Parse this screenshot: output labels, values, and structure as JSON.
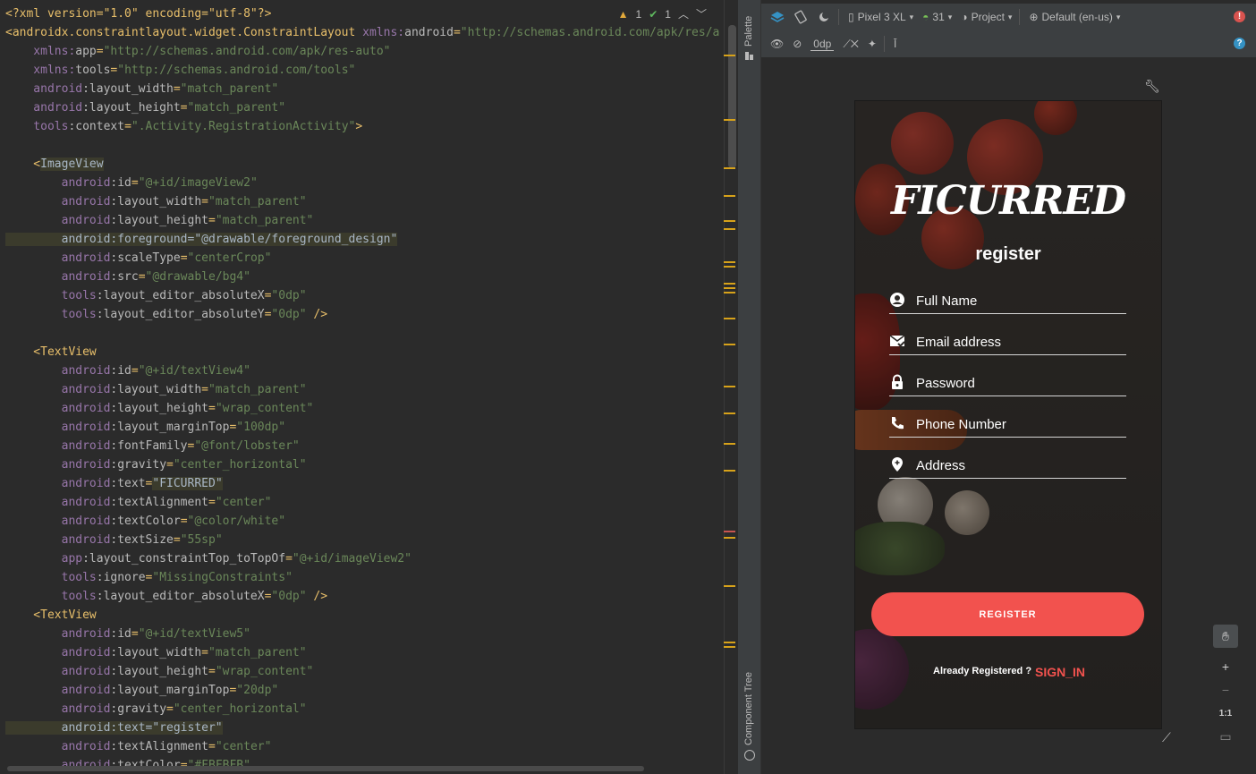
{
  "editor": {
    "inspection": {
      "warnings": "1",
      "typos": "1"
    },
    "lines": [
      [
        [
          "pi",
          "<?xml version=\"1.0\" encoding=\"utf-8\"?>"
        ]
      ],
      [
        [
          "lt",
          "<androidx.constraintlayout.widget.ConstraintLayout "
        ],
        [
          "ns",
          "xmlns:"
        ],
        [
          "an",
          "android"
        ],
        [
          "lt",
          "="
        ],
        [
          "av",
          "\"http://schemas.android.com/apk/res/a"
        ]
      ],
      [
        [
          "ns",
          "    xmlns:"
        ],
        [
          "an",
          "app"
        ],
        [
          "lt",
          "="
        ],
        [
          "av",
          "\"http://schemas.android.com/apk/res-auto\""
        ]
      ],
      [
        [
          "ns",
          "    xmlns:"
        ],
        [
          "an",
          "tools"
        ],
        [
          "lt",
          "="
        ],
        [
          "av",
          "\"http://schemas.android.com/tools\""
        ]
      ],
      [
        [
          "ns",
          "    android"
        ],
        [
          "an",
          ":layout_width"
        ],
        [
          "lt",
          "="
        ],
        [
          "av",
          "\"match_parent\""
        ]
      ],
      [
        [
          "ns",
          "    android"
        ],
        [
          "an",
          ":layout_height"
        ],
        [
          "lt",
          "="
        ],
        [
          "av",
          "\"match_parent\""
        ]
      ],
      [
        [
          "ns",
          "    tools"
        ],
        [
          "an",
          ":context"
        ],
        [
          "lt",
          "="
        ],
        [
          "av",
          "\".Activity.RegistrationActivity\""
        ],
        [
          "lt",
          ">"
        ]
      ],
      [
        [
          "an",
          ""
        ]
      ],
      [
        [
          "lt",
          "    <"
        ],
        [
          "hl",
          "ImageView"
        ]
      ],
      [
        [
          "ns",
          "        android"
        ],
        [
          "an",
          ":id"
        ],
        [
          "lt",
          "="
        ],
        [
          "av",
          "\"@+id/imageView2\""
        ]
      ],
      [
        [
          "ns",
          "        android"
        ],
        [
          "an",
          ":layout_width"
        ],
        [
          "lt",
          "="
        ],
        [
          "av",
          "\"match_parent\""
        ]
      ],
      [
        [
          "ns",
          "        android"
        ],
        [
          "an",
          ":layout_height"
        ],
        [
          "lt",
          "="
        ],
        [
          "av",
          "\"match_parent\""
        ]
      ],
      [
        [
          "hl",
          "        android:foreground=\"@drawable/foreground_design\""
        ]
      ],
      [
        [
          "ns",
          "        android"
        ],
        [
          "an",
          ":scaleType"
        ],
        [
          "lt",
          "="
        ],
        [
          "av",
          "\"centerCrop\""
        ]
      ],
      [
        [
          "ns",
          "        android"
        ],
        [
          "an",
          ":src"
        ],
        [
          "lt",
          "="
        ],
        [
          "av",
          "\"@drawable/bg4\""
        ]
      ],
      [
        [
          "ns",
          "        tools"
        ],
        [
          "an",
          ":layout_editor_absoluteX"
        ],
        [
          "lt",
          "="
        ],
        [
          "av",
          "\"0dp\""
        ]
      ],
      [
        [
          "ns",
          "        tools"
        ],
        [
          "an",
          ":layout_editor_absoluteY"
        ],
        [
          "lt",
          "="
        ],
        [
          "av",
          "\"0dp\""
        ],
        [
          "lt",
          " />"
        ]
      ],
      [
        [
          "an",
          ""
        ]
      ],
      [
        [
          "lt",
          "    <TextView"
        ]
      ],
      [
        [
          "ns",
          "        android"
        ],
        [
          "an",
          ":id"
        ],
        [
          "lt",
          "="
        ],
        [
          "av",
          "\"@+id/textView4\""
        ]
      ],
      [
        [
          "ns",
          "        android"
        ],
        [
          "an",
          ":layout_width"
        ],
        [
          "lt",
          "="
        ],
        [
          "av",
          "\"match_parent\""
        ]
      ],
      [
        [
          "ns",
          "        android"
        ],
        [
          "an",
          ":layout_height"
        ],
        [
          "lt",
          "="
        ],
        [
          "av",
          "\"wrap_content\""
        ]
      ],
      [
        [
          "ns",
          "        android"
        ],
        [
          "an",
          ":layout_marginTop"
        ],
        [
          "lt",
          "="
        ],
        [
          "av",
          "\"100dp\""
        ]
      ],
      [
        [
          "ns",
          "        android"
        ],
        [
          "an",
          ":fontFamily"
        ],
        [
          "lt",
          "="
        ],
        [
          "av",
          "\"@font/lobster\""
        ]
      ],
      [
        [
          "ns",
          "        android"
        ],
        [
          "an",
          ":gravity"
        ],
        [
          "lt",
          "="
        ],
        [
          "av",
          "\"center_horizontal\""
        ]
      ],
      [
        [
          "ns",
          "        android"
        ],
        [
          "an",
          ":text"
        ],
        [
          "lt",
          "="
        ],
        [
          "hl",
          "\"FICURRED\""
        ]
      ],
      [
        [
          "ns",
          "        android"
        ],
        [
          "an",
          ":textAlignment"
        ],
        [
          "lt",
          "="
        ],
        [
          "av",
          "\"center\""
        ]
      ],
      [
        [
          "ns",
          "        android"
        ],
        [
          "an",
          ":textColor"
        ],
        [
          "lt",
          "="
        ],
        [
          "av",
          "\"@color/white\""
        ]
      ],
      [
        [
          "ns",
          "        android"
        ],
        [
          "an",
          ":textSize"
        ],
        [
          "lt",
          "="
        ],
        [
          "av",
          "\"55sp\""
        ]
      ],
      [
        [
          "ns",
          "        app"
        ],
        [
          "an",
          ":layout_constraintTop_toTopOf"
        ],
        [
          "lt",
          "="
        ],
        [
          "av",
          "\"@+id/imageView2\""
        ]
      ],
      [
        [
          "ns",
          "        tools"
        ],
        [
          "an",
          ":ignore"
        ],
        [
          "lt",
          "="
        ],
        [
          "av",
          "\"MissingConstraints\""
        ]
      ],
      [
        [
          "ns",
          "        tools"
        ],
        [
          "an",
          ":layout_editor_absoluteX"
        ],
        [
          "lt",
          "="
        ],
        [
          "av",
          "\"0dp\""
        ],
        [
          "lt",
          " />"
        ]
      ],
      [
        [
          "lt",
          "    <TextView"
        ]
      ],
      [
        [
          "ns",
          "        android"
        ],
        [
          "an",
          ":id"
        ],
        [
          "lt",
          "="
        ],
        [
          "av",
          "\"@+id/textView5\""
        ]
      ],
      [
        [
          "ns",
          "        android"
        ],
        [
          "an",
          ":layout_width"
        ],
        [
          "lt",
          "="
        ],
        [
          "av",
          "\"match_parent\""
        ]
      ],
      [
        [
          "ns",
          "        android"
        ],
        [
          "an",
          ":layout_height"
        ],
        [
          "lt",
          "="
        ],
        [
          "av",
          "\"wrap_content\""
        ]
      ],
      [
        [
          "ns",
          "        android"
        ],
        [
          "an",
          ":layout_marginTop"
        ],
        [
          "lt",
          "="
        ],
        [
          "av",
          "\"20dp\""
        ]
      ],
      [
        [
          "ns",
          "        android"
        ],
        [
          "an",
          ":gravity"
        ],
        [
          "lt",
          "="
        ],
        [
          "av",
          "\"center_horizontal\""
        ]
      ],
      [
        [
          "hl",
          "        android:text=\"register\""
        ]
      ],
      [
        [
          "ns",
          "        android"
        ],
        [
          "an",
          ":textAlignment"
        ],
        [
          "lt",
          "="
        ],
        [
          "av",
          "\"center\""
        ]
      ],
      [
        [
          "ns",
          "        android"
        ],
        [
          "an",
          ":textColor"
        ],
        [
          "lt",
          "="
        ],
        [
          "av",
          "\"#FBFBFB\""
        ]
      ]
    ]
  },
  "side_panel": {
    "palette": "Palette",
    "component_tree": "Component Tree"
  },
  "toolbar": {
    "device": "Pixel 3 XL",
    "api": "31",
    "theme": "Project",
    "locale": "Default (en-us)",
    "margin": "0dp"
  },
  "app": {
    "brand": "FICURRED",
    "screen_title": "register",
    "fields": [
      {
        "label": "Full Name",
        "icon": "account-circle-icon"
      },
      {
        "label": "Email address",
        "icon": "email-check-icon"
      },
      {
        "label": "Password",
        "icon": "lock-icon"
      },
      {
        "label": "Phone Number",
        "icon": "phone-icon"
      },
      {
        "label": "Address",
        "icon": "location-pin-icon"
      }
    ],
    "register_button": "REGISTER",
    "already_registered": "Already Registered ?",
    "sign_in": "SIGN_IN"
  },
  "zoom": {
    "one_to_one": "1:1"
  },
  "colors": {
    "accent": "#f2524e",
    "editor_bg": "#2b2b2b",
    "toolbar_bg": "#3c3f41"
  }
}
